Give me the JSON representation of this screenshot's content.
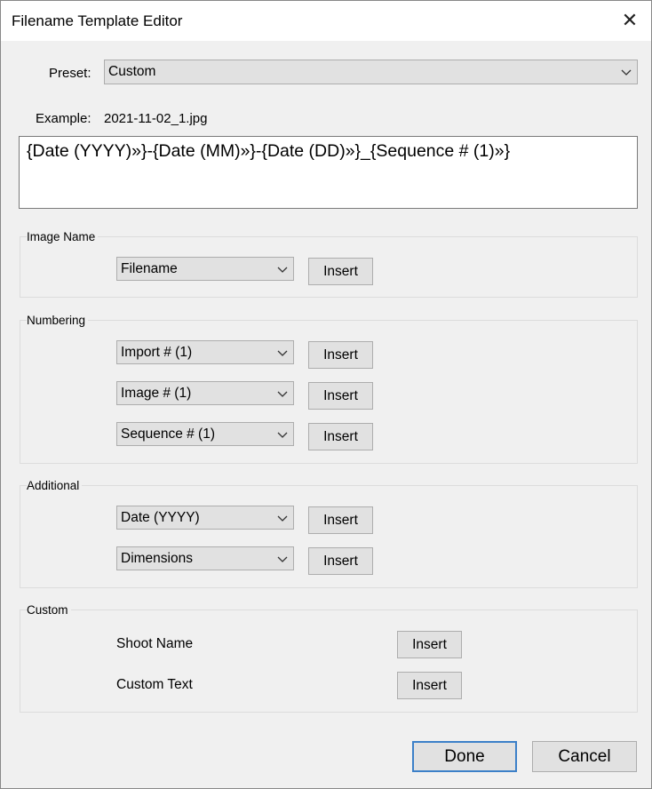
{
  "window": {
    "title": "Filename Template Editor"
  },
  "preset": {
    "label": "Preset:",
    "value": "Custom"
  },
  "example": {
    "label": "Example:",
    "value": "2021-11-02_1.jpg"
  },
  "template_text": "{Date (YYYY)»}-{Date (MM)»}-{Date (DD)»}_{Sequence # (1)»}",
  "groups": {
    "image_name": {
      "label": "Image Name",
      "rows": [
        {
          "select": "Filename",
          "button": "Insert"
        }
      ]
    },
    "numbering": {
      "label": "Numbering",
      "rows": [
        {
          "select": "Import # (1)",
          "button": "Insert"
        },
        {
          "select": "Image # (1)",
          "button": "Insert"
        },
        {
          "select": "Sequence # (1)",
          "button": "Insert"
        }
      ]
    },
    "additional": {
      "label": "Additional",
      "rows": [
        {
          "select": "Date (YYYY)",
          "button": "Insert"
        },
        {
          "select": "Dimensions",
          "button": "Insert"
        }
      ]
    },
    "custom": {
      "label": "Custom",
      "rows": [
        {
          "text": "Shoot Name",
          "button": "Insert"
        },
        {
          "text": "Custom Text",
          "button": "Insert"
        }
      ]
    }
  },
  "footer": {
    "done_label": "Done",
    "cancel_label": "Cancel"
  },
  "icons": {
    "close": "close-icon",
    "dropdown": "chevron-down-icon"
  },
  "colors": {
    "dialog_bg": "#f0f0f0",
    "button_bg": "#e1e1e1",
    "focus_border": "#3c80c8"
  }
}
